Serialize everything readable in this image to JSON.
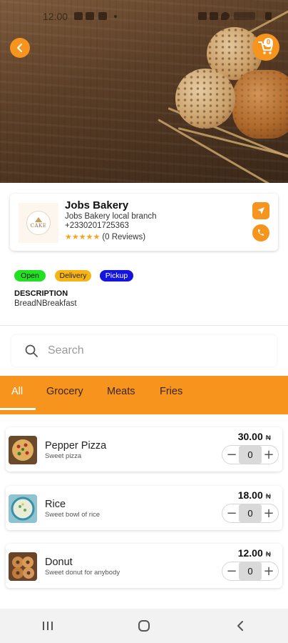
{
  "status_bar": {
    "time": "12:00"
  },
  "header": {
    "cart_count": "0"
  },
  "store": {
    "logo_text": "CAKE",
    "name": "Jobs Bakery",
    "branch": "Jobs Bakery local branch",
    "phone": "+2330201725363",
    "stars": "★★★★★",
    "reviews": "(0 Reviews)"
  },
  "tags": {
    "open": "Open",
    "delivery": "Delivery",
    "pickup": "Pickup"
  },
  "description": {
    "title": "DESCRIPTION",
    "text": "BreadNBreakfast"
  },
  "search": {
    "placeholder": "Search"
  },
  "categories": [
    {
      "label": "All",
      "active": true
    },
    {
      "label": "Grocery",
      "active": false
    },
    {
      "label": "Meats",
      "active": false
    },
    {
      "label": "Fries",
      "active": false
    }
  ],
  "products": [
    {
      "name": "Pepper Pizza",
      "description": "Sweet pizza",
      "price": "30.00",
      "currency": "₦",
      "quantity": "0"
    },
    {
      "name": "Rice",
      "description": "Sweet bowl of rice",
      "price": "18.00",
      "currency": "₦",
      "quantity": "0"
    },
    {
      "name": "Donut",
      "description": "Sweet donut for anybody",
      "price": "12.00",
      "currency": "₦",
      "quantity": "0"
    }
  ],
  "colors": {
    "accent": "#f7941d",
    "open_tag": "#22e022",
    "delivery_tag": "#f7b515",
    "pickup_tag": "#1414e0"
  }
}
